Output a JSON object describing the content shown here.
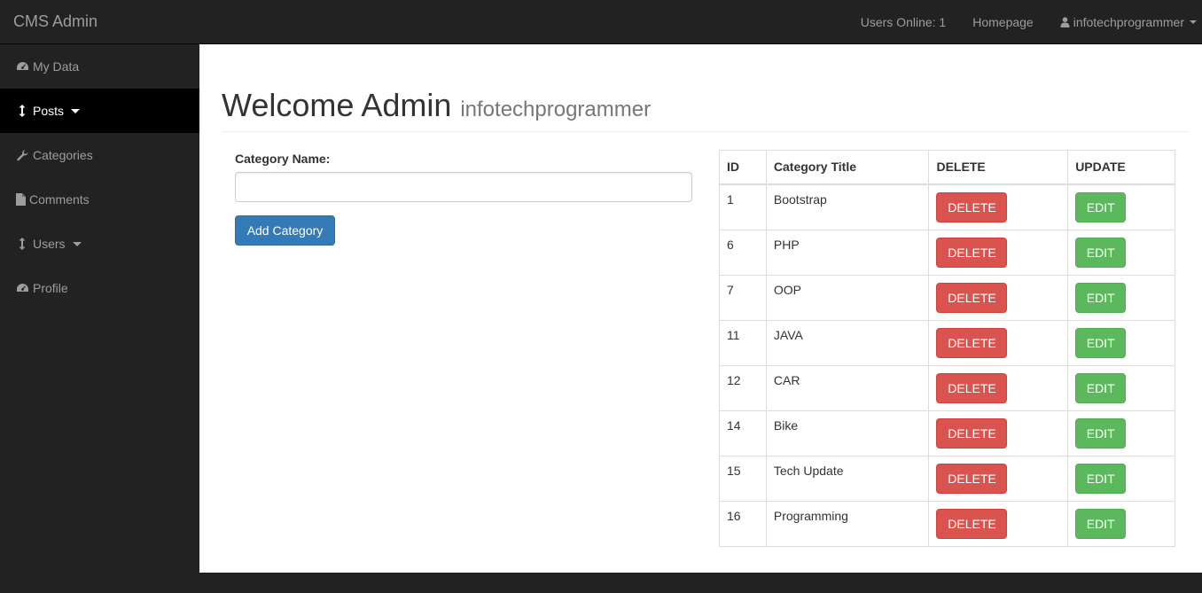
{
  "app": {
    "brand": "CMS Admin"
  },
  "topnav": {
    "users_online": "Users Online: 1",
    "homepage": "Homepage",
    "username": "infotechprogrammer"
  },
  "sidebar": {
    "items": [
      {
        "label": "My Data",
        "icon": "dashboard-icon"
      },
      {
        "label": "Posts",
        "icon": "arrows-v-icon",
        "active": true
      },
      {
        "label": "Categories",
        "icon": "wrench-icon"
      },
      {
        "label": "Comments",
        "icon": "file-icon"
      },
      {
        "label": "Users",
        "icon": "arrows-v-icon"
      },
      {
        "label": "Profile",
        "icon": "dashboard-icon"
      }
    ]
  },
  "page": {
    "title": "Welcome Admin",
    "subtitle": "infotechprogrammer"
  },
  "form": {
    "label": "Category Name:",
    "input_value": "",
    "submit_label": "Add Category"
  },
  "table": {
    "headers": [
      "ID",
      "Category Title",
      "DELETE",
      "UPDATE"
    ],
    "delete_label": "DELETE",
    "edit_label": "EDIT",
    "rows": [
      {
        "id": "1",
        "title": "Bootstrap"
      },
      {
        "id": "6",
        "title": "PHP"
      },
      {
        "id": "7",
        "title": "OOP"
      },
      {
        "id": "11",
        "title": "JAVA"
      },
      {
        "id": "12",
        "title": "CAR"
      },
      {
        "id": "14",
        "title": "Bike"
      },
      {
        "id": "15",
        "title": "Tech Update"
      },
      {
        "id": "16",
        "title": "Programming"
      }
    ]
  },
  "colors": {
    "navbar": "#222222",
    "primary": "#337ab7",
    "danger": "#d9534f",
    "success": "#5cb85c"
  }
}
